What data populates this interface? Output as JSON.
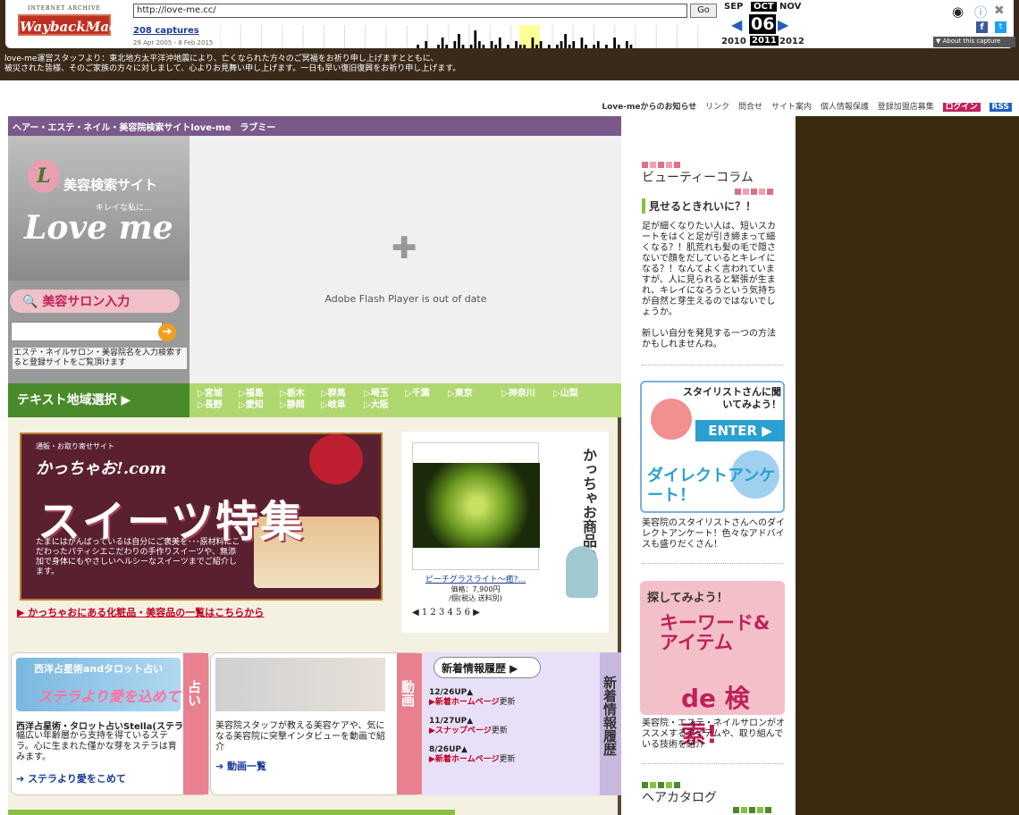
{
  "wayback": {
    "ia_text": "INTERNET ARCHIVE",
    "logo_text": "WaybackMachine",
    "url": "http://love-me.cc/",
    "go_label": "Go",
    "captures_link": "208 captures",
    "date_range": "29 Apr 2005 - 8 Feb 2015",
    "months": {
      "prev": "SEP",
      "current": "OCT",
      "next": "NOV"
    },
    "day": "06",
    "years": {
      "prev": "2010",
      "current": "2011",
      "next": "2012"
    },
    "about_label": "▼ About this capture",
    "sparkline": [
      0,
      0,
      0,
      1,
      0,
      2,
      0,
      0,
      1,
      3,
      1,
      0,
      2,
      4,
      1,
      0,
      1,
      5,
      2,
      1,
      0,
      2,
      1,
      3,
      0,
      1,
      0,
      2,
      1,
      1,
      0,
      3,
      1,
      2,
      0,
      1,
      0,
      1,
      2,
      4,
      1,
      2,
      0,
      3,
      1,
      0,
      1,
      2,
      0,
      1,
      0,
      3,
      1,
      0,
      2,
      1
    ]
  },
  "notice": {
    "line1": "love-me運営スタッフより：東北地方太平洋沖地震により、亡くなられた方々のご冥福をお祈り申し上げますとともに、",
    "line2": "被災された皆様、そのご家族の方々に対しまして、心よりお見舞い申し上げます。一日も早い復旧復興をお祈り申し上げます。"
  },
  "topnav": {
    "news": "Love-meからのお知らせ",
    "links": "リンク",
    "contact": "問合せ",
    "sitemap": "サイト案内",
    "privacy": "個人情報保護",
    "recruit": "登録加盟店募集",
    "login": "ログイン",
    "rss": "RSS"
  },
  "header": {
    "title": "ヘアー・エステ・ネイル・美容院検索サイトlove-me　ラブミー"
  },
  "left": {
    "l_mark": "L",
    "site_title": "美容検索サイト",
    "tagline": "キレイな私に…",
    "logo": "Love me",
    "salon_input_label": "美容サロン入力",
    "help_text": "エステ・ネイルサロン・美容院名を入力検索すると登録サイトをご覧頂けます"
  },
  "flash": {
    "message": "Adobe Flash Player is out of date"
  },
  "region": {
    "button": "テキスト地域選択 ▶",
    "row1": [
      "▷宮城",
      "▷福島",
      "▷栃木",
      "▷群馬",
      "▷埼玉",
      "▷千葉",
      "▷東京",
      "▷神奈川",
      "▷山梨"
    ],
    "row2": [
      "▷長野",
      "▷愛知",
      "▷静岡",
      "▷岐阜",
      "▷大阪"
    ]
  },
  "banner": {
    "small": "通販・お取り寄せサイト",
    "brand": "かっちゃお!.com",
    "big": "スイーツ特集",
    "desc": "たまにはがんばっているは自分にご褒美を･･･原材料にこだわったパティシエこだわりの手作りスイーツや、無添加で身体にもやさしいヘルシーなスイーツまでご紹介します。"
  },
  "cosmetics_link": "▶ かっちゃおにある化粧品・美容品の一覧はこちらから",
  "product": {
    "title": "かっちゃお商品の紹介",
    "name": "ピーチグラスライト～癒?...",
    "price": "価格：7,900円",
    "unit": "/個(税込 送料別)",
    "pager": "◀ 1 2 3 4 5 6 ▶"
  },
  "fortune": {
    "banner_title": "西洋占星術andタロット占い",
    "banner_script": "ステラより愛を込めて",
    "tab": "占い",
    "heading": "西洋占星術・タロット占いStella(ステラ)",
    "body": "幅広い年齢層から支持を得ているステラ。心に生まれた僅かな芽をステラは育みます。",
    "link": "ステラより愛をこめて"
  },
  "video": {
    "tab": "動画",
    "body": "美容院スタッフが教える美容ケアや、気になる美容院に突撃インタビューを動画で紹介",
    "link": "動画一覧"
  },
  "news": {
    "header": "新着情報履歴 ▶",
    "side": "新着情報履歴",
    "items": [
      {
        "date": "12/26UP▲",
        "link": "▶新着ホームページ",
        "suffix": "更新"
      },
      {
        "date": "11/27UP▲",
        "link": "▶スナップページ",
        "suffix": "更新"
      },
      {
        "date": "8/26UP▲",
        "link": "▶新着ホームページ",
        "suffix": "更新"
      }
    ]
  },
  "right": {
    "beauty_header": "ビューティーコラム",
    "beauty_sub": "見せるときれいに？！",
    "beauty_text": "足が細くなりたい人は、短いスカートをはくと足が引き締まって細くなる？！肌荒れも髪の毛で隠さないで顔をだしているとキレイになる？！なんてよく言われていますが、人に見られると緊張が生まれ、キレイになろうという気持ちが自然と芽生えるのではないでしょうか。",
    "beauty_text2": "新しい自分を発見する一つの方法かもしれませんね。",
    "stylist_title": "スタイリストさんに聞いてみよう！",
    "stylist_enter": "ENTER ▶",
    "stylist_direct": "ダイレクトアンケート！",
    "stylist_text": "美容院のスタイリストさんへのダイレクトアンケート！色々なアドバイスも盛りだくさん！",
    "keyword_a": "探してみよう！",
    "keyword_b": "キーワード&アイテム",
    "keyword_c": "de 検索!",
    "keyword_text": "美容院・エステ・ネイルサロンがオススメするアイテムや、取り組んでいる技術を紹介",
    "hair_header": "ヘアカタログ"
  },
  "colors": {
    "wayback_bg": "#3a2a1a",
    "header_purple": "#7a5a8a",
    "region_green": "#4a8a2a",
    "accent_pink": "#c0205a",
    "right_bg": "#3a2a10"
  }
}
